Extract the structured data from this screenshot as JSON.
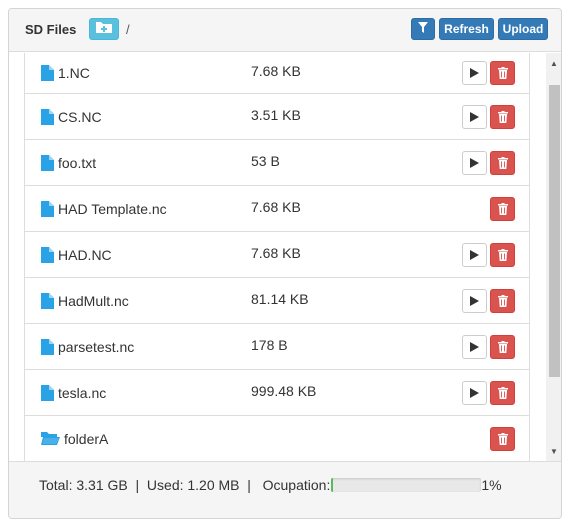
{
  "header": {
    "title": "SD Files",
    "path": "/",
    "refresh_label": "Refresh",
    "upload_label": "Upload"
  },
  "files": [
    {
      "name": "1.NC",
      "size": "7.68 KB",
      "type": "file",
      "playable": true
    },
    {
      "name": "CS.NC",
      "size": "3.51 KB",
      "type": "file",
      "playable": true
    },
    {
      "name": "foo.txt",
      "size": "53 B",
      "type": "file",
      "playable": true
    },
    {
      "name": "HAD Template.nc",
      "size": "7.68 KB",
      "type": "file",
      "playable": false
    },
    {
      "name": "HAD.NC",
      "size": "7.68 KB",
      "type": "file",
      "playable": true
    },
    {
      "name": "HadMult.nc",
      "size": "81.14 KB",
      "type": "file",
      "playable": true
    },
    {
      "name": "parsetest.nc",
      "size": "178 B",
      "type": "file",
      "playable": true
    },
    {
      "name": "tesla.nc",
      "size": "999.48 KB",
      "type": "file",
      "playable": true
    },
    {
      "name": "folderA",
      "size": "",
      "type": "folder",
      "playable": false
    }
  ],
  "footer": {
    "total": "Total: 3.31 GB",
    "used": "Used: 1.20 MB",
    "occupation_label": "Ocupation:",
    "occupation_percent": "1%",
    "occupation_value": 0.01
  },
  "colors": {
    "primary": "#337ab7",
    "info": "#5bc0de",
    "danger": "#d9534f",
    "file_icon": "#2aa3e6",
    "progress": "#5cb85c"
  }
}
